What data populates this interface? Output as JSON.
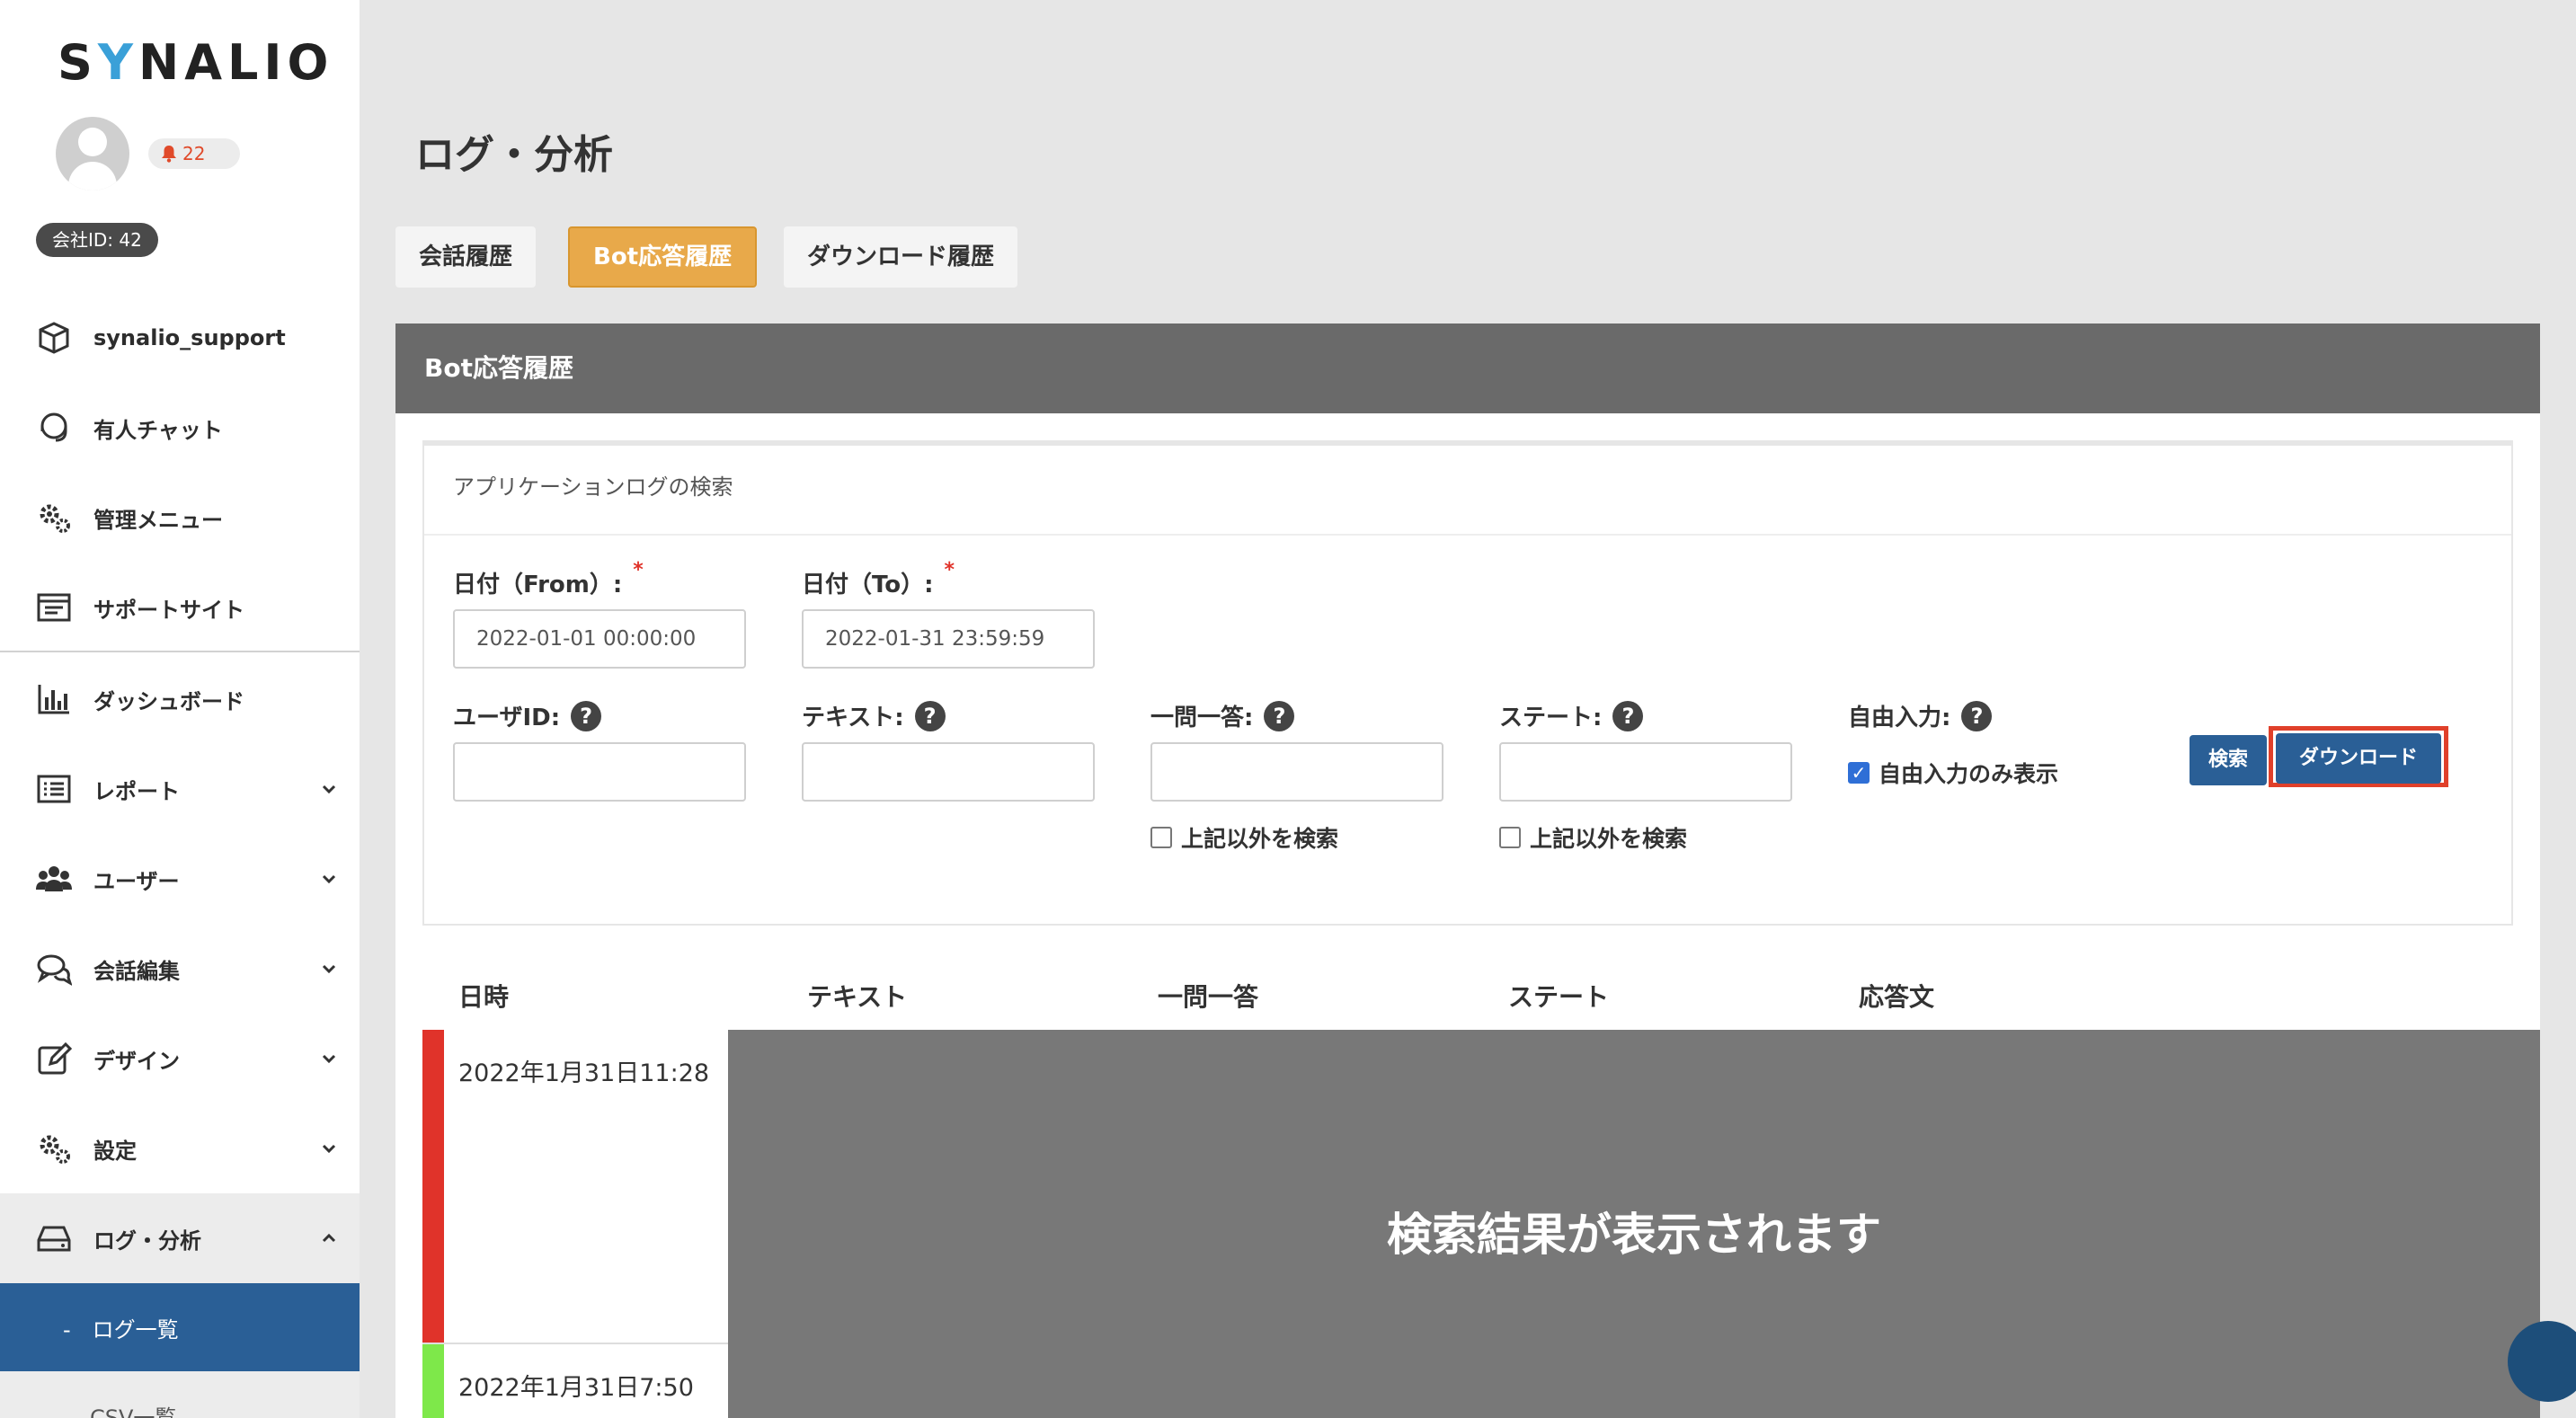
{
  "brand": {
    "logo_prefix": "S",
    "logo_y": "Y",
    "logo_suffix": "NALIO"
  },
  "user": {
    "notifications": "22",
    "company_id": "会社ID: 42"
  },
  "sidebar": {
    "items": [
      {
        "label": "synalio_support",
        "icon": "box-icon"
      },
      {
        "label": "有人チャット",
        "icon": "headset-icon"
      },
      {
        "label": "管理メニュー",
        "icon": "gears-icon"
      },
      {
        "label": "サポートサイト",
        "icon": "browser-icon"
      },
      {
        "label": "ダッシュボード",
        "icon": "bar-chart-icon"
      },
      {
        "label": "レポート",
        "icon": "list-icon"
      },
      {
        "label": "ユーザー",
        "icon": "users-icon"
      },
      {
        "label": "会話編集",
        "icon": "chat-icon"
      },
      {
        "label": "デザイン",
        "icon": "edit-icon"
      },
      {
        "label": "設定",
        "icon": "gears-icon"
      },
      {
        "label": "ログ・分析",
        "icon": "hdd-icon"
      }
    ],
    "sub_items": [
      "-　ログ一覧",
      "CSV一覧"
    ]
  },
  "page": {
    "title": "ログ・分析",
    "tabs": [
      "会話履歴",
      "Bot応答履歴",
      "ダウンロード履歴"
    ],
    "active_tab": "Bot応答履歴"
  },
  "panel": {
    "title": "Bot応答履歴",
    "search_title": "アプリケーションログの検索",
    "date_from_label": "日付（From）:",
    "date_from_value": "2022-01-01 00:00:00",
    "date_to_label": "日付（To）:",
    "date_to_value": "2022-01-31 23:59:59",
    "required_mark": "*",
    "help_mark": "?",
    "user_id_label": "ユーザID:",
    "text_label": "テキスト:",
    "qa_label": "一問一答:",
    "state_label": "ステート:",
    "free_input_label": "自由入力:",
    "exclude_label": "上記以外を検索",
    "free_only_label": "自由入力のみ表示",
    "free_only_checked": true,
    "search_button": "検索",
    "download_button": "ダウンロード"
  },
  "table": {
    "headers": [
      "日時",
      "テキスト",
      "一問一答",
      "ステート",
      "応答文"
    ],
    "rows": [
      {
        "datetime": "2022年1月31日11:28",
        "color": "#e0332a"
      },
      {
        "datetime": "2022年1月31日7:50",
        "color": "#7ee84a"
      }
    ],
    "overlay_text": "検索結果が表示されます"
  }
}
